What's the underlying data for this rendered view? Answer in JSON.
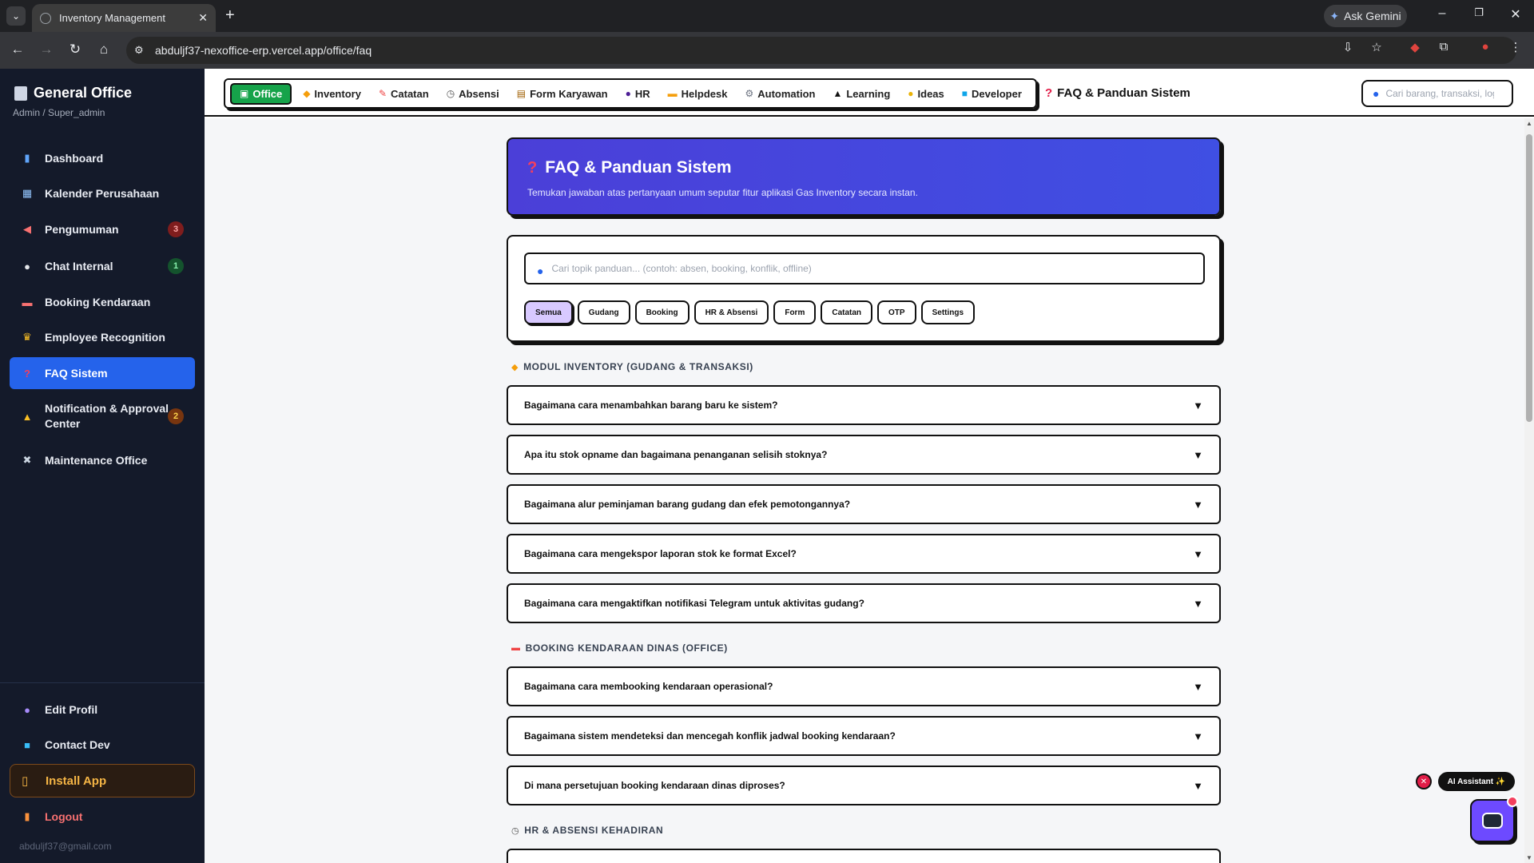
{
  "browser": {
    "tab_title": "Inventory Management",
    "url": "abduljf37-nexoffice-erp.vercel.app/office/faq",
    "gemini_label": "Ask Gemini"
  },
  "sidebar": {
    "brand": "General Office",
    "role": "Admin / Super_admin",
    "items": [
      {
        "label": "Dashboard",
        "icon": "chart-icon",
        "badge": ""
      },
      {
        "label": "Kalender Perusahaan",
        "icon": "calendar-icon",
        "badge": ""
      },
      {
        "label": "Pengumuman",
        "icon": "megaphone-icon",
        "badge": "3"
      },
      {
        "label": "Chat Internal",
        "icon": "chat-bubble-icon",
        "badge": "1"
      },
      {
        "label": "Booking Kendaraan",
        "icon": "car-icon",
        "badge": ""
      },
      {
        "label": "Employee Recognition",
        "icon": "trophy-icon",
        "badge": ""
      },
      {
        "label": "FAQ Sistem",
        "icon": "question-icon",
        "badge": ""
      },
      {
        "label_line1": "Notification & Approval",
        "label_line2": "Center",
        "icon": "bell-icon",
        "badge": "2"
      },
      {
        "label": "Maintenance Office",
        "icon": "tools-icon",
        "badge": ""
      }
    ],
    "bottom": {
      "edit_profile": "Edit Profil",
      "contact_dev": "Contact Dev",
      "install_app": "Install App",
      "logout": "Logout",
      "email": "abduljf37@gmail.com"
    }
  },
  "topnav": {
    "items": [
      "Office",
      "Inventory",
      "Catatan",
      "Absensi",
      "Form Karyawan",
      "HR",
      "Helpdesk",
      "Automation",
      "Learning",
      "Ideas",
      "Developer"
    ],
    "page_title": "FAQ & Panduan Sistem",
    "search_placeholder": "Cari barang, transaksi, log..."
  },
  "hero": {
    "title": "FAQ & Panduan Sistem",
    "subtitle": "Temukan jawaban atas pertanyaan umum seputar fitur aplikasi Gas Inventory secara instan."
  },
  "faq_search": {
    "placeholder": "Cari topik panduan... (contoh: absen, booking, konflik, offline)"
  },
  "filters": [
    "Semua",
    "Gudang",
    "Booking",
    "HR & Absensi",
    "Form",
    "Catatan",
    "OTP",
    "Settings"
  ],
  "sections": [
    {
      "title": "MODUL INVENTORY (GUDANG & TRANSAKSI)",
      "questions": [
        "Bagaimana cara menambahkan barang baru ke sistem?",
        "Apa itu stok opname dan bagaimana penanganan selisih stoknya?",
        "Bagaimana alur peminjaman barang gudang dan efek pemotongannya?",
        "Bagaimana cara mengekspor laporan stok ke format Excel?",
        "Bagaimana cara mengaktifkan notifikasi Telegram untuk aktivitas gudang?"
      ]
    },
    {
      "title": "BOOKING KENDARAAN DINAS (OFFICE)",
      "questions": [
        "Bagaimana cara membooking kendaraan operasional?",
        "Bagaimana sistem mendeteksi dan mencegah konflik jadwal booking kendaraan?",
        "Di mana persetujuan booking kendaraan dinas diproses?"
      ]
    },
    {
      "title": "HR & ABSENSI KEHADIRAN",
      "questions": []
    }
  ],
  "ai": {
    "label": "AI Assistant ✨"
  },
  "colors": {
    "accent": "#2563eb",
    "sidebar_bg": "#141a2a",
    "hero_bg": "#4b3fd8",
    "office_tab": "#16a34a"
  }
}
